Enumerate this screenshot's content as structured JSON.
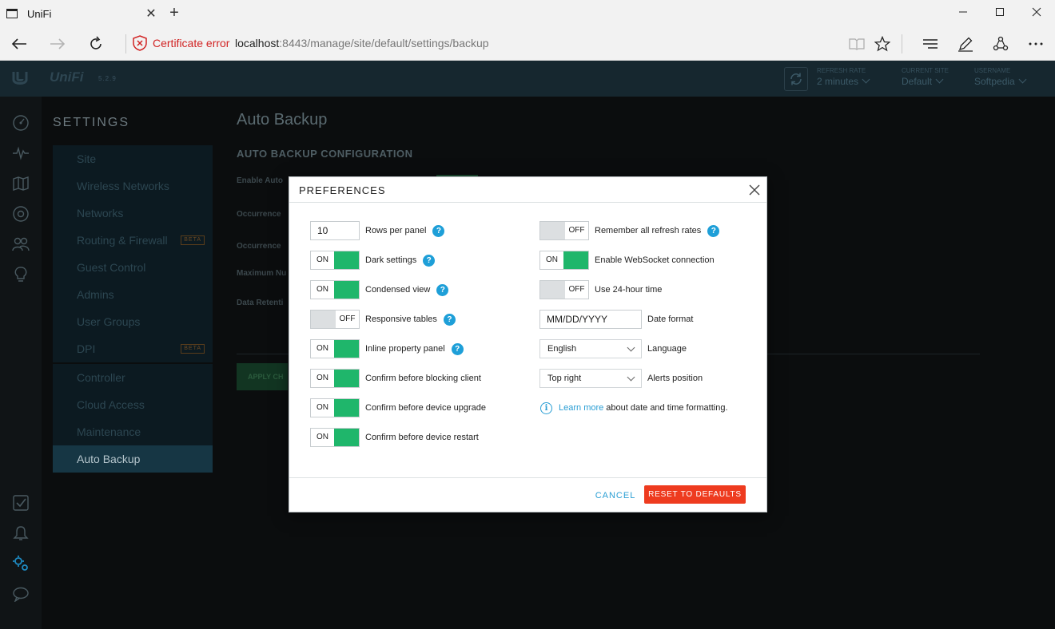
{
  "browser": {
    "tab_title": "UniFi",
    "cert_error": "Certificate error",
    "url_host": "localhost",
    "url_rest": ":8443/manage/site/default/settings/backup"
  },
  "header": {
    "brand": "UniFi",
    "version": "5.2.9",
    "refresh_rate_label": "REFRESH RATE",
    "refresh_rate_value": "2 minutes",
    "current_site_label": "CURRENT SITE",
    "current_site_value": "Default",
    "username_label": "USERNAME",
    "username_value": "Softpedia"
  },
  "sidebar": {
    "title": "SETTINGS",
    "group1": [
      {
        "label": "Site"
      },
      {
        "label": "Wireless Networks"
      },
      {
        "label": "Networks"
      },
      {
        "label": "Routing & Firewall",
        "badge": "BETA"
      },
      {
        "label": "Guest Control"
      },
      {
        "label": "Admins"
      },
      {
        "label": "User Groups"
      },
      {
        "label": "DPI",
        "badge": "BETA"
      }
    ],
    "group2": [
      {
        "label": "Controller"
      },
      {
        "label": "Cloud Access"
      },
      {
        "label": "Maintenance"
      },
      {
        "label": "Auto Backup"
      }
    ]
  },
  "page": {
    "title": "Auto Backup",
    "section": "AUTO BACKUP CONFIGURATION",
    "labels": [
      "Enable Auto",
      "Occurrence",
      "Occurrence",
      "Maximum Nu",
      "Data Retenti"
    ],
    "apply_button": "APPLY CH"
  },
  "dialog": {
    "title": "PREFERENCES",
    "rows_per_panel_value": "10",
    "rows_per_panel_label": "Rows per panel",
    "toggles_left": [
      {
        "state": "ON",
        "label": "Dark settings",
        "help": true
      },
      {
        "state": "ON",
        "label": "Condensed view",
        "help": true
      },
      {
        "state": "OFF",
        "label": "Responsive tables",
        "help": true
      },
      {
        "state": "ON",
        "label": "Inline property panel",
        "help": true
      },
      {
        "state": "ON",
        "label": "Confirm before blocking client",
        "help": false
      },
      {
        "state": "ON",
        "label": "Confirm before device upgrade",
        "help": false
      },
      {
        "state": "ON",
        "label": "Confirm before device restart",
        "help": false
      }
    ],
    "toggles_right": [
      {
        "state": "OFF",
        "label": "Remember all refresh rates",
        "help": true
      },
      {
        "state": "ON",
        "label": "Enable WebSocket connection",
        "help": false
      },
      {
        "state": "OFF",
        "label": "Use 24-hour time",
        "help": false
      }
    ],
    "date_format_value": "MM/DD/YYYY",
    "date_format_label": "Date format",
    "language_value": "English",
    "language_label": "Language",
    "alerts_value": "Top right",
    "alerts_label": "Alerts position",
    "learn_more": "Learn more",
    "learn_more_suffix": "about date and time formatting.",
    "cancel": "CANCEL",
    "reset": "RESET TO DEFAULTS",
    "help_glyph": "?",
    "info_glyph": "i"
  },
  "colors": {
    "accent_green": "#1fb66b",
    "link_blue": "#2a9ed4",
    "reset_red": "#ee3b1f",
    "cert_red": "#d12323"
  }
}
